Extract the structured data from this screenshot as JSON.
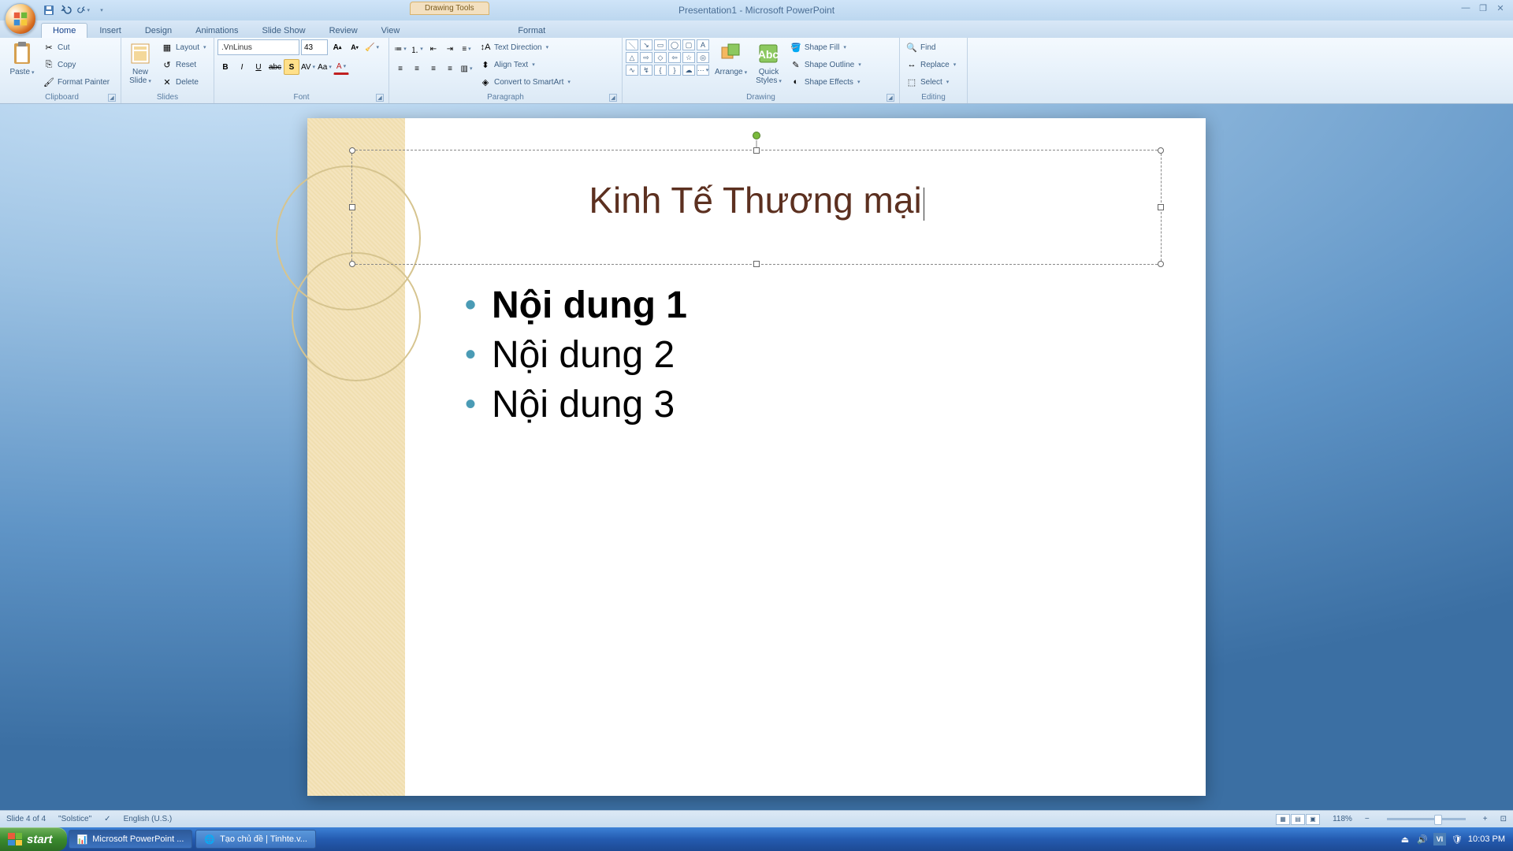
{
  "titlebar": {
    "app_title": "Presentation1 - Microsoft PowerPoint",
    "contextual_tab": "Drawing Tools"
  },
  "tabs": {
    "home": "Home",
    "insert": "Insert",
    "design": "Design",
    "animations": "Animations",
    "slideshow": "Slide Show",
    "review": "Review",
    "view": "View",
    "format": "Format"
  },
  "ribbon": {
    "clipboard": {
      "label": "Clipboard",
      "paste": "Paste",
      "cut": "Cut",
      "copy": "Copy",
      "format_painter": "Format Painter"
    },
    "slides": {
      "label": "Slides",
      "new_slide": "New\nSlide",
      "layout": "Layout",
      "reset": "Reset",
      "delete": "Delete"
    },
    "font": {
      "label": "Font",
      "family": ".VnLinus",
      "size": "43"
    },
    "paragraph": {
      "label": "Paragraph",
      "text_direction": "Text Direction",
      "align_text": "Align Text",
      "convert_smartart": "Convert to SmartArt"
    },
    "drawing": {
      "label": "Drawing",
      "arrange": "Arrange",
      "quick_styles": "Quick\nStyles",
      "shape_fill": "Shape Fill",
      "shape_outline": "Shape Outline",
      "shape_effects": "Shape Effects"
    },
    "editing": {
      "label": "Editing",
      "find": "Find",
      "replace": "Replace",
      "select": "Select"
    }
  },
  "slide": {
    "title_text": "Kinh Tế Thương mại",
    "bullets": [
      "Nội dung 1",
      "Nội dung 2",
      "Nội dung 3"
    ]
  },
  "statusbar": {
    "slide_info": "Slide 4 of 4",
    "theme": "\"Solstice\"",
    "language": "English (U.S.)",
    "zoom": "118%"
  },
  "taskbar": {
    "start": "start",
    "items": [
      "Microsoft PowerPoint ...",
      "Tạo chủ đề | Tinhte.v..."
    ],
    "time": "10:03 PM"
  }
}
